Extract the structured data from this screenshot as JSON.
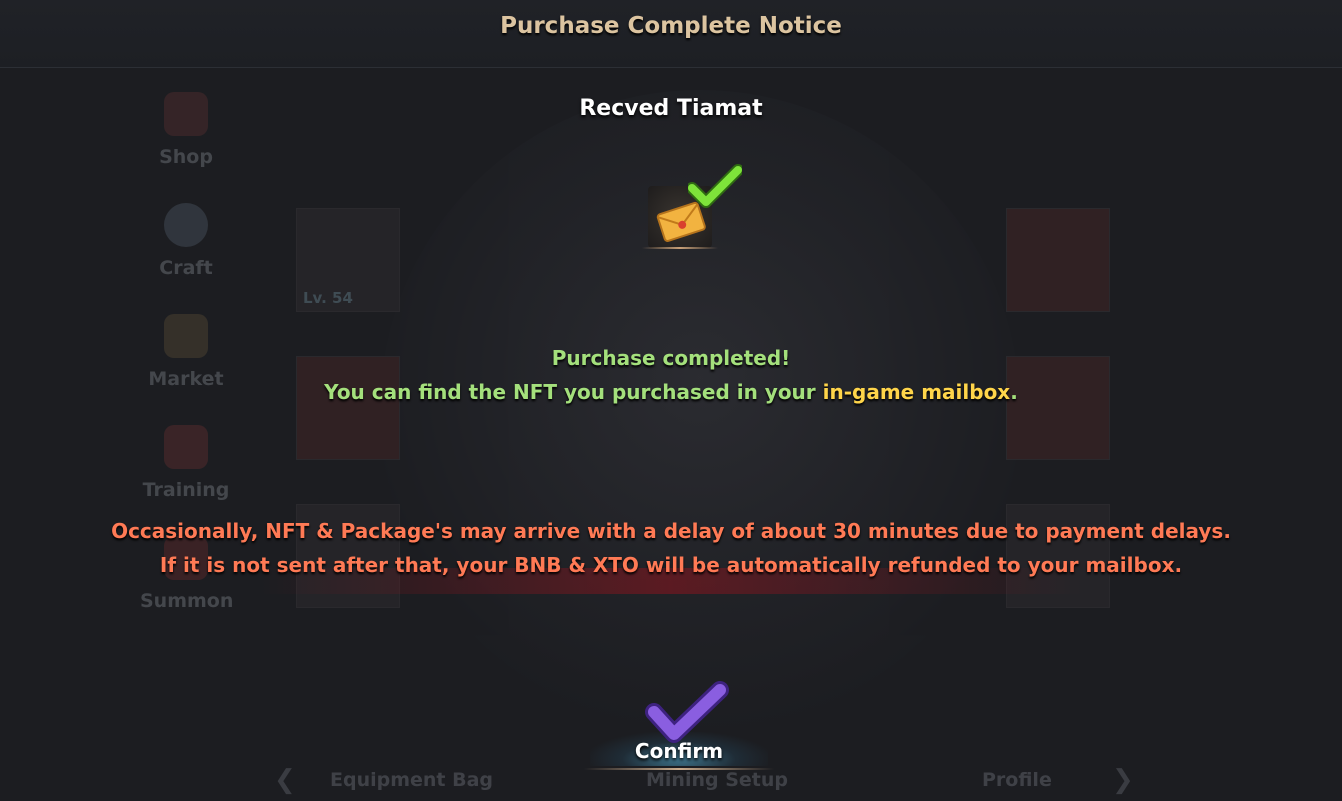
{
  "background": {
    "side_menu": [
      "Shop",
      "Craft",
      "Market",
      "Training",
      "Summon"
    ],
    "slot_level": "Lv. 54",
    "bottom_nav": {
      "tabs": [
        "Equipment Bag",
        "Mining Setup",
        "Profile"
      ],
      "prev_icon": "chevron-left-icon",
      "next_icon": "chevron-right-icon"
    }
  },
  "dialog": {
    "title": "Purchase Complete Notice",
    "item_name": "Recved Tiamat",
    "item_icon": "mail-envelope-icon",
    "status_icon": "green-check-icon",
    "success_title": "Purchase completed!",
    "success_text_prefix": "You can find the NFT you purchased in your ",
    "success_text_highlight": "in-game mailbox",
    "success_text_suffix": ".",
    "warning_line_1": "Occasionally,  NFT & Package's may arrive with a delay of about 30 minutes due to payment delays.",
    "warning_line_2": "If it is not sent after that,  your BNB & XTO will be automatically refunded to your mailbox.",
    "confirm_label": "Confirm",
    "confirm_icon": "purple-check-icon"
  },
  "colors": {
    "title_gold": "#dcc4a0",
    "success_green": "#a4e07c",
    "highlight_yellow": "#ffd54a",
    "warning_orange": "#ff7a55",
    "confirm_purple": "#8a5ee0",
    "check_green": "#7ee33a"
  }
}
